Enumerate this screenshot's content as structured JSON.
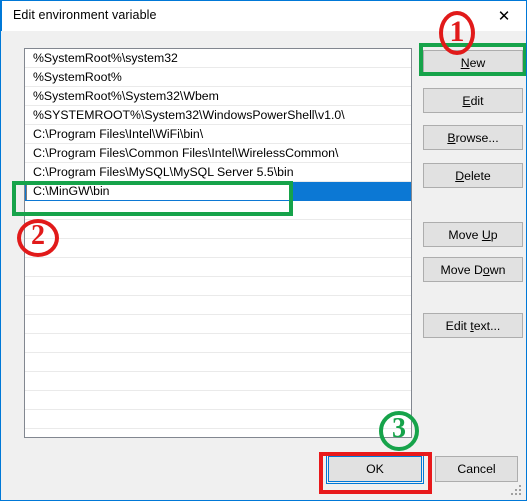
{
  "window": {
    "title": "Edit environment variable",
    "close_icon": "close-icon",
    "close_glyph": "✕"
  },
  "list": {
    "entries": [
      "%SystemRoot%\\system32",
      "%SystemRoot%",
      "%SystemRoot%\\System32\\Wbem",
      "%SYSTEMROOT%\\System32\\WindowsPowerShell\\v1.0\\",
      "C:\\Program Files\\Intel\\WiFi\\bin\\",
      "C:\\Program Files\\Common Files\\Intel\\WirelessCommon\\",
      "C:\\Program Files\\MySQL\\MySQL Server 5.5\\bin"
    ],
    "selected_row_value": "C:\\MinGW\\bin",
    "empty_row_count": 12,
    "selection_color": "#0c78d4"
  },
  "side_buttons": {
    "new": {
      "pre": "",
      "accel": "N",
      "post": "ew"
    },
    "edit": {
      "pre": "",
      "accel": "E",
      "post": "dit"
    },
    "browse": {
      "pre": "",
      "accel": "B",
      "post": "rowse..."
    },
    "delete": {
      "pre": "",
      "accel": "D",
      "post": "elete"
    },
    "move_up": {
      "pre": "Move ",
      "accel": "U",
      "post": "p"
    },
    "move_down": {
      "pre": "Move D",
      "accel": "o",
      "post": "wn"
    },
    "edit_text": {
      "pre": "Edit ",
      "accel": "t",
      "post": "ext..."
    }
  },
  "bottom_buttons": {
    "ok": "OK",
    "cancel": "Cancel"
  },
  "annotations": {
    "marker_1": "1",
    "marker_2": "2",
    "marker_3": "3",
    "red_color": "#e11a1a",
    "green_color": "#16a34a",
    "rect_new_color": "#16a34a",
    "rect_edit_color": "#16a34a",
    "rect_ok_color": "#e8191b"
  }
}
